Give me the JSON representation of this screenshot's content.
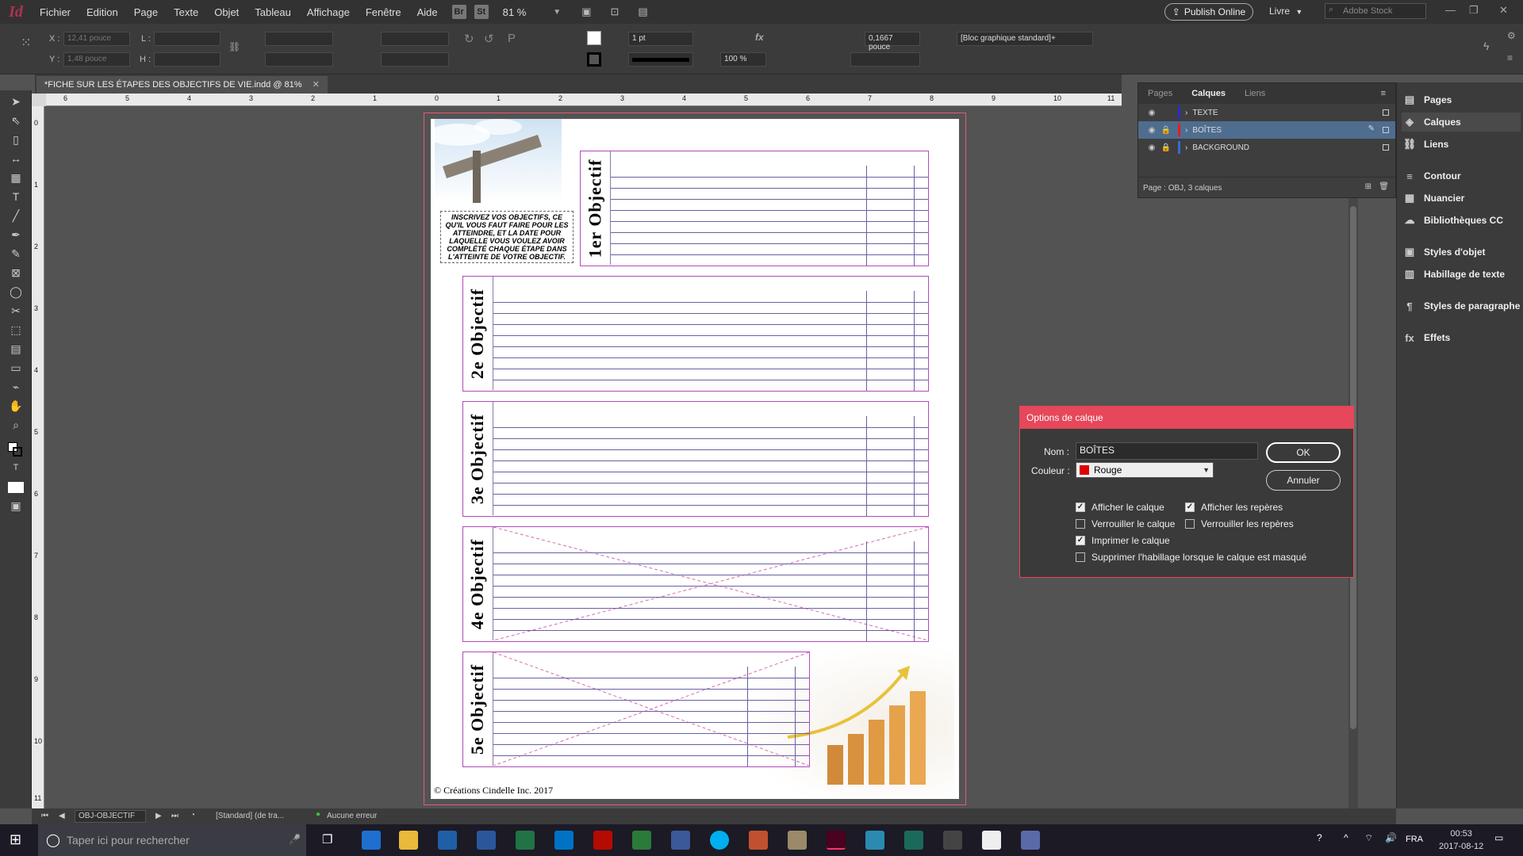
{
  "app": {
    "logo": "Id",
    "zoom": "81 %",
    "chip_br": "Br",
    "chip_st": "St"
  },
  "menu": [
    "Fichier",
    "Edition",
    "Page",
    "Texte",
    "Objet",
    "Tableau",
    "Affichage",
    "Fenêtre",
    "Aide"
  ],
  "topright": {
    "publish": "Publish Online",
    "workspace": "Livre",
    "stock_placeholder": "Adobe Stock"
  },
  "control": {
    "x_label": "X :",
    "x_value": "12,41 pouce",
    "y_label": "Y :",
    "y_value": "1,48 pouce",
    "w_label": "L :",
    "h_label": "H :",
    "stroke_weight": "1 pt",
    "scale": "100 %",
    "gap": "0,1667 pouce",
    "style": "[Bloc graphique standard]+"
  },
  "document": {
    "tab_title": "*FICHE SUR LES ÉTAPES DES OBJECTIFS DE VIE.indd @ 81%"
  },
  "ruler_h": [
    "6",
    "5",
    "4",
    "3",
    "2",
    "1",
    "0",
    "1",
    "2",
    "3",
    "4",
    "5",
    "6",
    "7",
    "8",
    "9",
    "10",
    "11"
  ],
  "ruler_v": [
    "0",
    "1",
    "2",
    "3",
    "4",
    "5",
    "6",
    "7",
    "8",
    "9",
    "10",
    "11"
  ],
  "page": {
    "instructions": "INSCRIVEZ VOS OBJECTIFS, CE QU'IL VOUS FAUT FAIRE POUR LES ATTEINDRE, ET LA DATE POUR LAQUELLE VOUS VOULEZ AVOIR COMPLÉTÉ CHAQUE ÉTAPE DANS L'ATTEINTE DE VOTRE OBJECTIF.",
    "objectives": [
      "1er Objectif",
      "2e Objectif",
      "3e Objectif",
      "4e Objectif",
      "5e Objectif"
    ],
    "footer": "© Créations Cindelle Inc. 2017"
  },
  "layers_panel": {
    "tabs": [
      "Pages",
      "Calques",
      "Liens"
    ],
    "active_tab": "Calques",
    "layers": [
      {
        "name": "TEXTE",
        "color": "#2a2ad0",
        "locked": false,
        "selected": false
      },
      {
        "name": "BOÎTES",
        "color": "#e02020",
        "locked": true,
        "selected": true
      },
      {
        "name": "BACKGROUND",
        "color": "#3a6ad0",
        "locked": true,
        "selected": false
      }
    ],
    "footer": "Page : OBJ, 3 calques"
  },
  "dock": [
    "Pages",
    "Calques",
    "Liens",
    "Contour",
    "Nuancier",
    "Bibliothèques CC",
    "Styles d'objet",
    "Habillage de texte",
    "Styles de paragraphe",
    "Effets"
  ],
  "dialog": {
    "title": "Options de calque",
    "name_label": "Nom :",
    "name_value": "BOÎTES",
    "color_label": "Couleur :",
    "color_value": "Rouge",
    "color_hex": "#e00000",
    "ok": "OK",
    "cancel": "Annuler",
    "checks": [
      {
        "label": "Afficher le calque",
        "checked": true
      },
      {
        "label": "Afficher les repères",
        "checked": true
      },
      {
        "label": "Verrouiller le calque",
        "checked": false
      },
      {
        "label": "Verrouiller les repères",
        "checked": false
      },
      {
        "label": "Imprimer le calque",
        "checked": true
      },
      {
        "label": "Supprimer l'habillage lorsque le calque est masqué",
        "checked": false
      }
    ]
  },
  "status": {
    "page": "OBJ-OBJECTIF",
    "style": "[Standard] (de tra...",
    "errors": "Aucune erreur"
  },
  "taskbar": {
    "search": "Taper ici pour rechercher",
    "lang": "FRA",
    "time": "00:53",
    "date": "2017-08-12"
  }
}
